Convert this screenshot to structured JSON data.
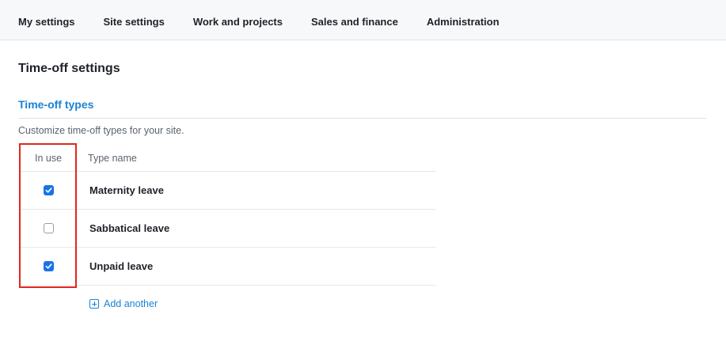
{
  "nav": {
    "tabs": [
      {
        "label": "My settings"
      },
      {
        "label": "Site settings"
      },
      {
        "label": "Work and projects"
      },
      {
        "label": "Sales and finance"
      },
      {
        "label": "Administration"
      }
    ]
  },
  "page": {
    "title": "Time-off settings"
  },
  "section": {
    "title": "Time-off types",
    "description": "Customize time-off types for your site."
  },
  "table": {
    "headers": {
      "in_use": "In use",
      "type_name": "Type name"
    },
    "rows": [
      {
        "name": "Maternity leave",
        "in_use": true
      },
      {
        "name": "Sabbatical leave",
        "in_use": false
      },
      {
        "name": "Unpaid leave",
        "in_use": true
      }
    ]
  },
  "actions": {
    "add_another": "Add another"
  },
  "colors": {
    "accent": "#1a82d6",
    "checkbox": "#1a73e8",
    "highlight": "#e0271d"
  },
  "icons": {
    "add": "plus-square-icon",
    "check": "checkmark-icon"
  }
}
